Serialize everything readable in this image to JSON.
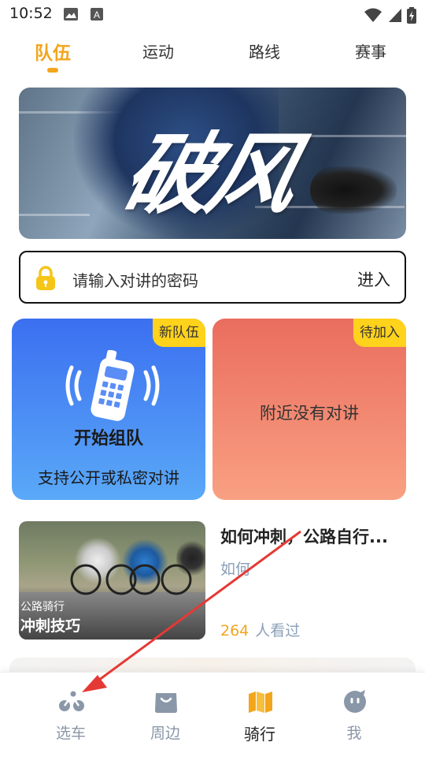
{
  "status_bar": {
    "time": "10:52"
  },
  "tabs": [
    {
      "label": "队伍",
      "active": true
    },
    {
      "label": "运动",
      "active": false
    },
    {
      "label": "路线",
      "active": false
    },
    {
      "label": "赛事",
      "active": false
    }
  ],
  "banner": {
    "title": "破风"
  },
  "password_box": {
    "placeholder": "请输入对讲的密码",
    "enter_label": "进入"
  },
  "cards": {
    "create": {
      "tag": "新队伍",
      "title": "开始组队",
      "subtitle": "支持公开或私密对讲"
    },
    "join": {
      "tag": "待加入",
      "message": "附近没有对讲"
    }
  },
  "article": {
    "thumb_caption_small": "公路骑行",
    "thumb_caption_big": "冲刺技巧",
    "title": "如何冲刺，公路自行...",
    "subtitle": "如何",
    "view_count": "264",
    "view_suffix": "人看过"
  },
  "bottom_nav": [
    {
      "label": "选车",
      "icon": "bike-icon",
      "active": false
    },
    {
      "label": "周边",
      "icon": "shopping-bag-icon",
      "active": false
    },
    {
      "label": "骑行",
      "icon": "map-icon",
      "active": true
    },
    {
      "label": "我",
      "icon": "face-icon",
      "active": false
    }
  ],
  "colors": {
    "accent": "#f3a51c",
    "tag_yellow": "#ffd21c",
    "card_blue": "#3b6ff0",
    "card_red": "#ea6d5e",
    "annotation_arrow": "#e53935"
  }
}
